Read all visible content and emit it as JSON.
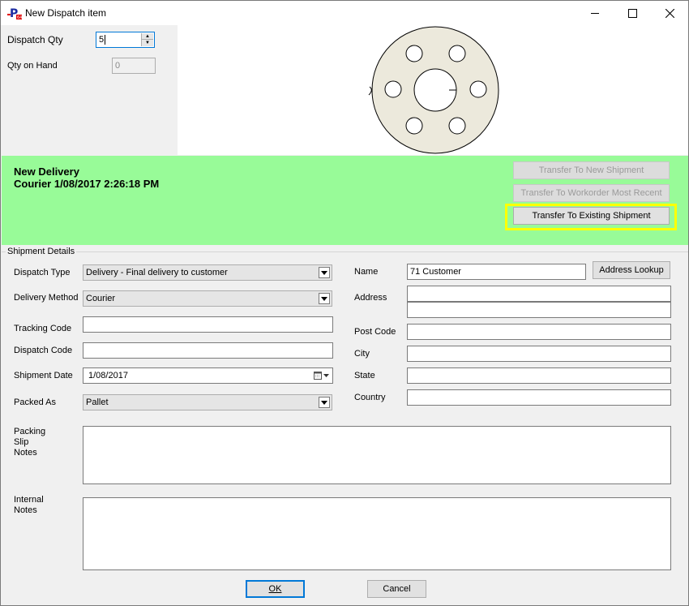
{
  "window": {
    "title": "New Dispatch item",
    "app_icon": "P-app-icon",
    "controls": {
      "minimize": "minimize-icon",
      "maximize": "maximize-icon",
      "close": "close-icon"
    }
  },
  "qty": {
    "dispatch_qty_label": "Dispatch Qty",
    "dispatch_qty_value": "5",
    "qty_on_hand_label": "Qty on Hand",
    "qty_on_hand_value": "0"
  },
  "delivery": {
    "title": "New Delivery",
    "subtitle": "Courier 1/08/2017 2:26:18 PM",
    "background_color": "#98fb98",
    "buttons": {
      "transfer_new": "Transfer To New Shipment",
      "transfer_workorder": "Transfer To Workorder Most Recent",
      "transfer_existing": "Transfer To Existing Shipment"
    },
    "highlight_color": "#ffff00"
  },
  "shipment": {
    "group_title": "Shipment Details",
    "dispatch_type_label": "Dispatch Type",
    "dispatch_type_value": "Delivery - Final delivery to customer",
    "delivery_method_label": "Delivery Method",
    "delivery_method_value": "Courier",
    "tracking_code_label": "Tracking Code",
    "tracking_code_value": "",
    "dispatch_code_label": "Dispatch Code",
    "dispatch_code_value": "",
    "shipment_date_label": "Shipment Date",
    "shipment_date_value": "1/08/2017",
    "packed_as_label": "Packed As",
    "packed_as_value": "Pallet",
    "name_label": "Name",
    "name_value": "71 Customer",
    "address_lookup": "Address Lookup",
    "address_label": "Address",
    "address_line1": "",
    "address_line2": "",
    "post_code_label": "Post Code",
    "post_code_value": "",
    "city_label": "City",
    "city_value": "",
    "state_label": "State",
    "state_value": "",
    "country_label": "Country",
    "country_value": "",
    "packing_slip_notes_label_1": "Packing",
    "packing_slip_notes_label_2": "Slip",
    "packing_slip_notes_label_3": "Notes",
    "internal_notes_label_1": "Internal",
    "internal_notes_label_2": "Notes"
  },
  "footer": {
    "ok": "OK",
    "cancel": "Cancel"
  }
}
